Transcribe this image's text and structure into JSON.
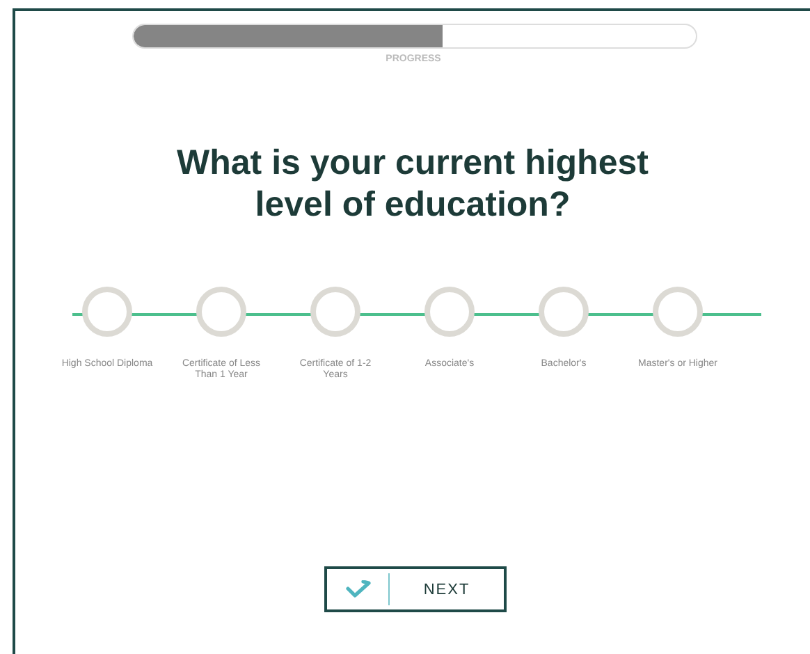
{
  "progress": {
    "level": 0.55,
    "label": "PROGRESS"
  },
  "question": "What is your current highest level of education?",
  "options": [
    {
      "label": "High School Diploma",
      "selected": false
    },
    {
      "label": "Certificate of Less Than 1 Year",
      "selected": false
    },
    {
      "label": "Certificate of 1-2 Years",
      "selected": false
    },
    {
      "label": "Associate's",
      "selected": false
    },
    {
      "label": "Bachelor's",
      "selected": false
    },
    {
      "label": "Master's or Higher",
      "selected": false
    }
  ],
  "next_button": "NEXT"
}
